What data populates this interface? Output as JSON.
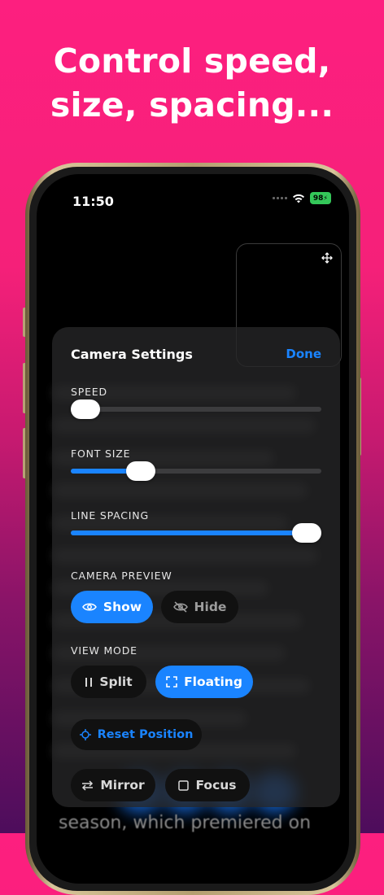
{
  "headline": {
    "line1": "Control speed,",
    "line2": "size, spacing..."
  },
  "status": {
    "time": "11:50",
    "battery": "98"
  },
  "panel": {
    "title": "Camera Settings",
    "done_label": "Done",
    "speed": {
      "label": "SPEED",
      "value": 0.06
    },
    "font_size": {
      "label": "FONT SIZE",
      "value": 0.28
    },
    "line_spacing": {
      "label": "LINE SPACING",
      "value": 0.94
    },
    "camera_preview": {
      "label": "CAMERA PREVIEW",
      "show_label": "Show",
      "hide_label": "Hide",
      "selected": "Show"
    },
    "view_mode": {
      "label": "VIEW MODE",
      "split_label": "Split",
      "floating_label": "Floating",
      "selected": "Floating"
    },
    "reset_label": "Reset Position",
    "mirror_label": "Mirror",
    "focus_label": "Focus"
  },
  "background_text": "season, which premiered on",
  "colors": {
    "accent": "#1a84ff",
    "background_top": "#fd1f7f",
    "background_bottom": "#4d0d5c"
  }
}
